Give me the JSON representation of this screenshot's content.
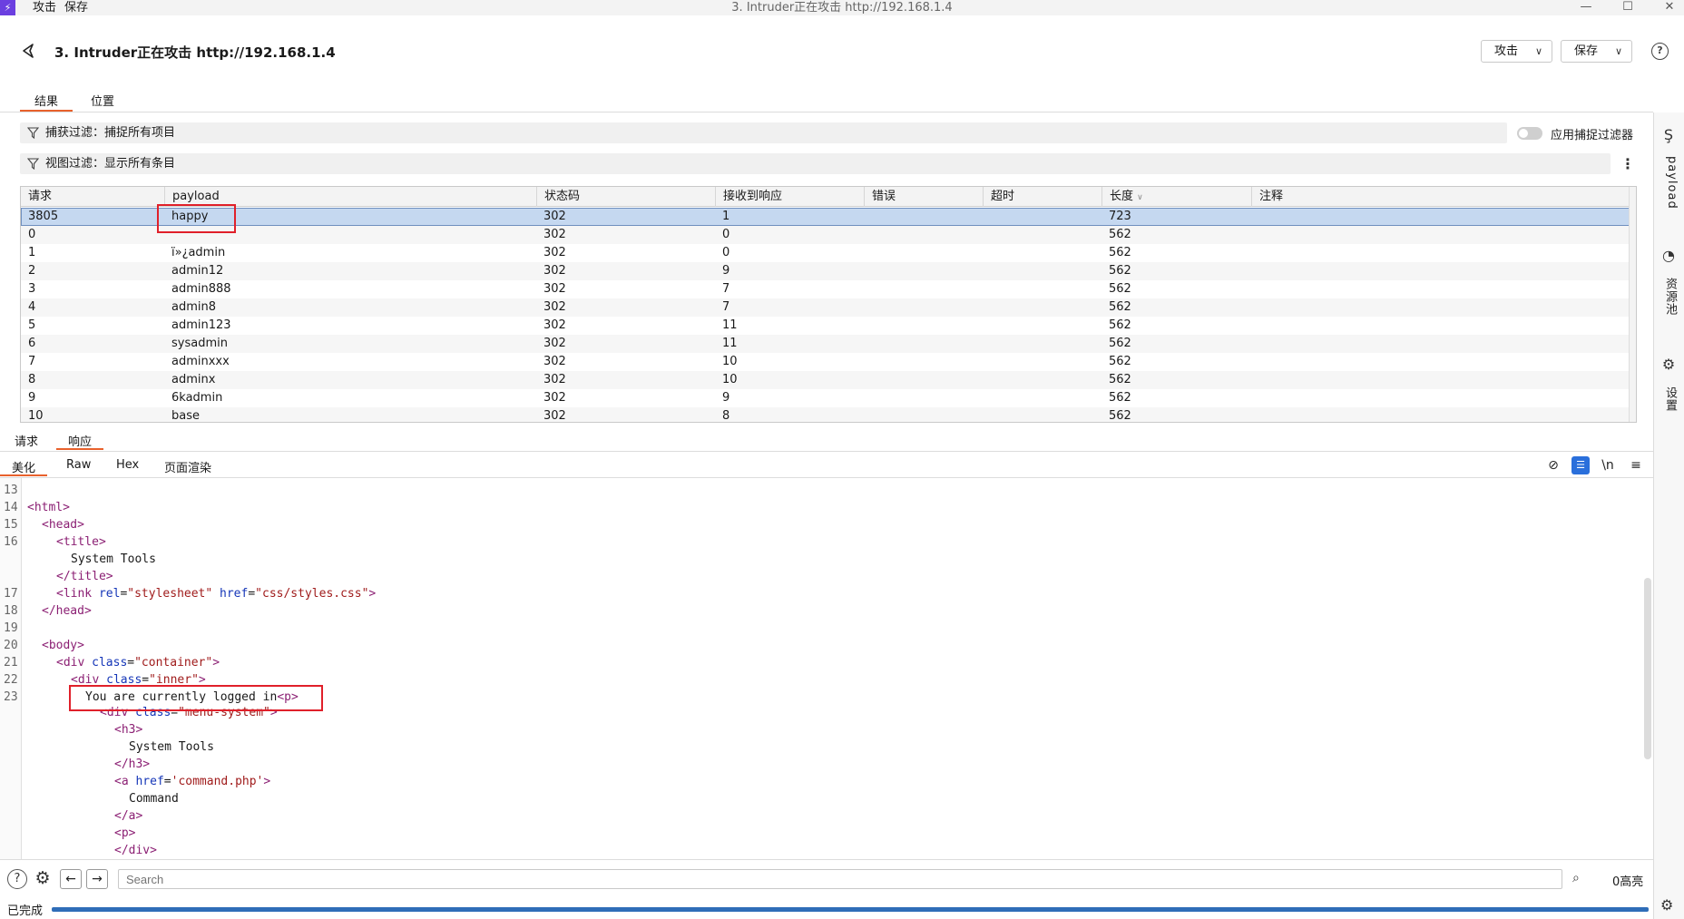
{
  "titlebar": {
    "logo": "⚡",
    "menu": [
      "攻击",
      "保存"
    ],
    "window_title": "3. Intruder正在攻击 http://192.168.1.4"
  },
  "header": {
    "title": "3. Intruder正在攻击 http://192.168.1.4",
    "attack_btn": "攻击",
    "save_btn": "保存",
    "help": "?"
  },
  "tabs": [
    "结果",
    "位置"
  ],
  "filters": {
    "capture": "捕获过滤：捕捉所有项目",
    "view": "视图过滤：显示所有条目",
    "apply_label": "应用捕捉过滤器",
    "apply_on": false
  },
  "sidebar": [
    "payload",
    "资源池",
    "设置"
  ],
  "table": {
    "columns": [
      "请求",
      "payload",
      "状态码",
      "接收到响应",
      "错误",
      "超时",
      "长度",
      "注释"
    ],
    "sort_column": "长度",
    "rows": [
      [
        "3805",
        "happy",
        "302",
        "1",
        "",
        "",
        "723",
        ""
      ],
      [
        "0",
        "",
        "302",
        "0",
        "",
        "",
        "562",
        ""
      ],
      [
        "1",
        "ï»¿admin",
        "302",
        "0",
        "",
        "",
        "562",
        ""
      ],
      [
        "2",
        "admin12",
        "302",
        "9",
        "",
        "",
        "562",
        ""
      ],
      [
        "3",
        "admin888",
        "302",
        "7",
        "",
        "",
        "562",
        ""
      ],
      [
        "4",
        "admin8",
        "302",
        "7",
        "",
        "",
        "562",
        ""
      ],
      [
        "5",
        "admin123",
        "302",
        "11",
        "",
        "",
        "562",
        ""
      ],
      [
        "6",
        "sysadmin",
        "302",
        "11",
        "",
        "",
        "562",
        ""
      ],
      [
        "7",
        "adminxxx",
        "302",
        "10",
        "",
        "",
        "562",
        ""
      ],
      [
        "8",
        "adminx",
        "302",
        "10",
        "",
        "",
        "562",
        ""
      ],
      [
        "9",
        "6kadmin",
        "302",
        "9",
        "",
        "",
        "562",
        ""
      ],
      [
        "10",
        "base",
        "302",
        "8",
        "",
        "",
        "562",
        ""
      ]
    ]
  },
  "req_resp_tabs": [
    "请求",
    "响应"
  ],
  "view_tabs": [
    "美化",
    "Raw",
    "Hex",
    "页面渲染"
  ],
  "view_icons": {
    "newline": "\\n",
    "menu": "≡"
  },
  "code": {
    "line_numbers": [
      "13",
      "14",
      "15",
      "16",
      "",
      "",
      "17",
      "18",
      "19",
      "20",
      "21",
      "22",
      "23"
    ],
    "texts": {
      "system_tools": "System Tools",
      "logged_in": "You are currently logged in",
      "command": "Command"
    }
  },
  "bottom": {
    "search_placeholder": "Search",
    "highlight_count": "0高亮",
    "status": "已完成",
    "progress": 1.0
  }
}
